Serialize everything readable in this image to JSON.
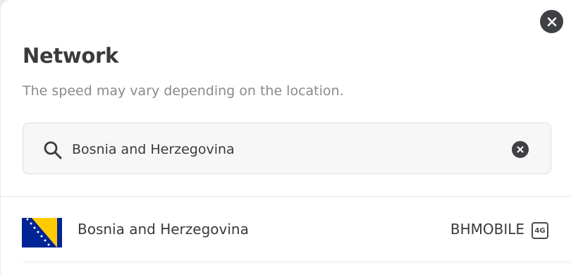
{
  "dialog": {
    "title": "Network",
    "subtitle": "The speed may vary depending on the location.",
    "close_icon": "close-icon"
  },
  "search": {
    "value": "Bosnia and Herzegovina",
    "icon": "search-icon",
    "clear_icon": "clear-icon"
  },
  "results": [
    {
      "country": "Bosnia and Herzegovina",
      "flag": "bosnia-and-herzegovina-flag",
      "carrier": "BHMOBILE",
      "network_type": "4G"
    }
  ],
  "colors": {
    "text_primary": "#3a3a3a",
    "text_secondary": "#8a8a8a",
    "dark_button": "#3e4043",
    "flag_blue": "#002395",
    "flag_yellow": "#fecb00"
  }
}
